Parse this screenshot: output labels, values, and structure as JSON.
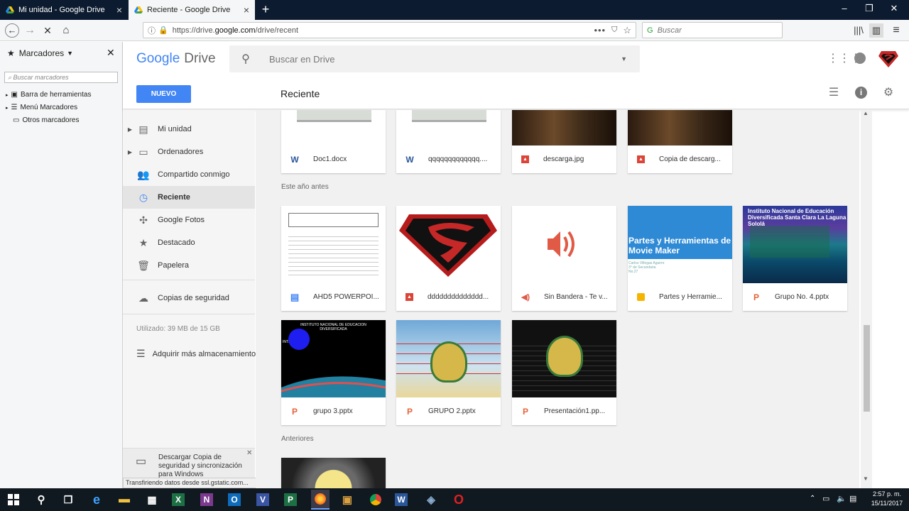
{
  "browser": {
    "tabs": [
      {
        "title": "Mi unidad - Google Drive"
      },
      {
        "title": "Reciente - Google Drive"
      }
    ],
    "url_prefix": "https://drive.",
    "url_host": "google.com",
    "url_path": "/drive/recent",
    "search_placeholder": "Buscar"
  },
  "bookmarks": {
    "title": "Marcadores",
    "search_placeholder": "Buscar marcadores",
    "items": [
      "Barra de herramientas",
      "Menú Marcadores",
      "Otros marcadores"
    ]
  },
  "drive": {
    "logo_google": "Google",
    "logo_drive": "Drive",
    "search_placeholder": "Buscar en Drive",
    "new_button": "NUEVO",
    "page_title": "Reciente",
    "nav": [
      {
        "label": "Mi unidad"
      },
      {
        "label": "Ordenadores"
      },
      {
        "label": "Compartido conmigo"
      },
      {
        "label": "Reciente"
      },
      {
        "label": "Google Fotos"
      },
      {
        "label": "Destacado"
      },
      {
        "label": "Papelera"
      },
      {
        "label": "Copias de seguridad"
      }
    ],
    "storage": "Utilizado: 39 MB de 15 GB",
    "buy_storage": "Adquirir más almacenamiento",
    "download_banner": "Descargar Copia de seguridad y sincronización para Windows",
    "status": "Transfiriendo datos desde ssl.gstatic.com..."
  },
  "sections": {
    "this_year": "Este año antes",
    "older": "Anteriores"
  },
  "files_top": [
    {
      "name": "Doc1.docx",
      "icon": "W"
    },
    {
      "name": "qqqqqqqqqqqqq....",
      "icon": "W"
    },
    {
      "name": "descarga.jpg",
      "icon": "img"
    },
    {
      "name": "Copia de descarg...",
      "icon": "img"
    }
  ],
  "files_row2": [
    {
      "name": "AHD5 POWERPOI...",
      "icon": "doc"
    },
    {
      "name": "dddddddddddddd...",
      "icon": "img"
    },
    {
      "name": "Sin Bandera - Te v...",
      "icon": "audio"
    },
    {
      "name": "Partes y Herramie...",
      "icon": "slides"
    },
    {
      "name": "Grupo No. 4.pptx",
      "icon": "P"
    }
  ],
  "files_row3": [
    {
      "name": "grupo 3.pptx",
      "icon": "P"
    },
    {
      "name": "GRUPO 2.pptx",
      "icon": "P"
    },
    {
      "name": "Presentación1.pp...",
      "icon": "P"
    }
  ],
  "thumb_text": {
    "partes_title": "Partes y Herramientas de Movie Maker",
    "partes_sub": "Carlos Villegas Aguirre",
    "partes_sub2": "3° de Secundaria",
    "partes_sub3": "No.27",
    "grupo4_title": "Instituto Nacional de Educación Diversificada Santa Clara La Laguna Sololá",
    "grupo3_title": "INSTITUTO NACIONAL DE EDUCACION DIVERSIFICADA",
    "grupo3_sub": "INTEGRANTES:"
  },
  "clock": {
    "time": "2:57 p. m.",
    "date": "15/11/2017"
  },
  "colors": {
    "accent": "#4285f4",
    "ppt": "#e4643a",
    "word": "#2b579a",
    "image": "#db4437",
    "slides": "#f4b400"
  }
}
